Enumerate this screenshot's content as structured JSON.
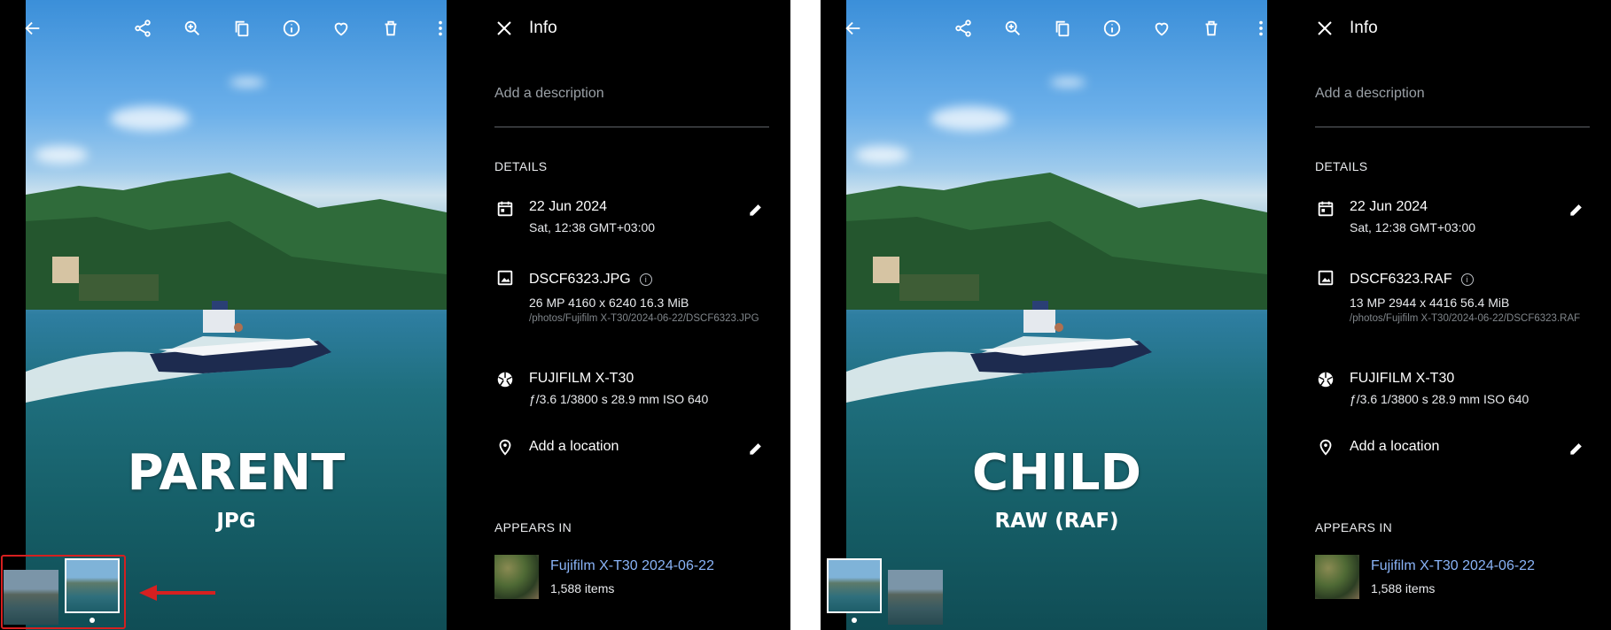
{
  "colors": {
    "accent_link": "#8ab4f8",
    "highlight": "#d62020",
    "panel_bg": "#000000"
  },
  "toolbar": {
    "icons": [
      "back-arrow-icon",
      "share-icon",
      "zoom-in-icon",
      "copy-icon",
      "info-icon",
      "favorite-icon",
      "delete-icon",
      "more-vert-icon"
    ]
  },
  "panels": [
    {
      "overlay": {
        "title": "PARENT",
        "subtitle": "JPG"
      },
      "info": {
        "title": "Info",
        "description_placeholder": "Add a description",
        "details_heading": "DETAILS",
        "date": "22 Jun 2024",
        "date_sub": "Sat, 12:38 GMT+03:00",
        "filename": "DSCF6323.JPG",
        "file_specs": "26 MP  4160 x 6240  16.3 MiB",
        "file_path": "/photos/Fujifilm X-T30/2024-06-22/DSCF6323.JPG",
        "camera": "FUJIFILM X-T30",
        "camera_specs": "ƒ/3.6  1/3800 s  28.9 mm  ISO 640",
        "location": "Add a location",
        "appears_heading": "APPEARS IN",
        "album_title": "Fujifilm X-T30 2024-06-22",
        "album_count": "1,588 items"
      }
    },
    {
      "overlay": {
        "title": "CHILD",
        "subtitle": "RAW (RAF)"
      },
      "info": {
        "title": "Info",
        "description_placeholder": "Add a description",
        "details_heading": "DETAILS",
        "date": "22 Jun 2024",
        "date_sub": "Sat, 12:38 GMT+03:00",
        "filename": "DSCF6323.RAF",
        "file_specs": "13 MP  2944 x 4416  56.4 MiB",
        "file_path": "/photos/Fujifilm X-T30/2024-06-22/DSCF6323.RAF",
        "camera": "FUJIFILM X-T30",
        "camera_specs": "ƒ/3.6  1/3800 s  28.9 mm  ISO 640",
        "location": "Add a location",
        "appears_heading": "APPEARS IN",
        "album_title": "Fujifilm X-T30 2024-06-22",
        "album_count": "1,588 items"
      }
    }
  ]
}
